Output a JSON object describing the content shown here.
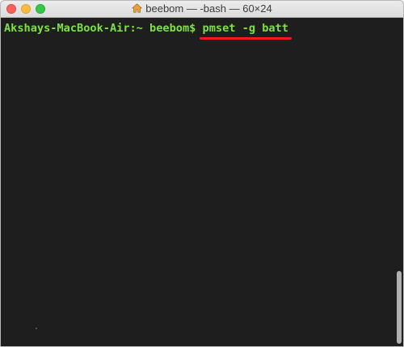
{
  "window": {
    "title": "beebom — -bash — 60×24",
    "title_icon": "home-icon"
  },
  "terminal": {
    "prompt": "Akshays-MacBook-Air:~ beebom$ ",
    "command": "pmset -g batt",
    "text_color": "#7ee044",
    "background": "#1e1e1e",
    "highlight_color": "#f01c1c"
  }
}
